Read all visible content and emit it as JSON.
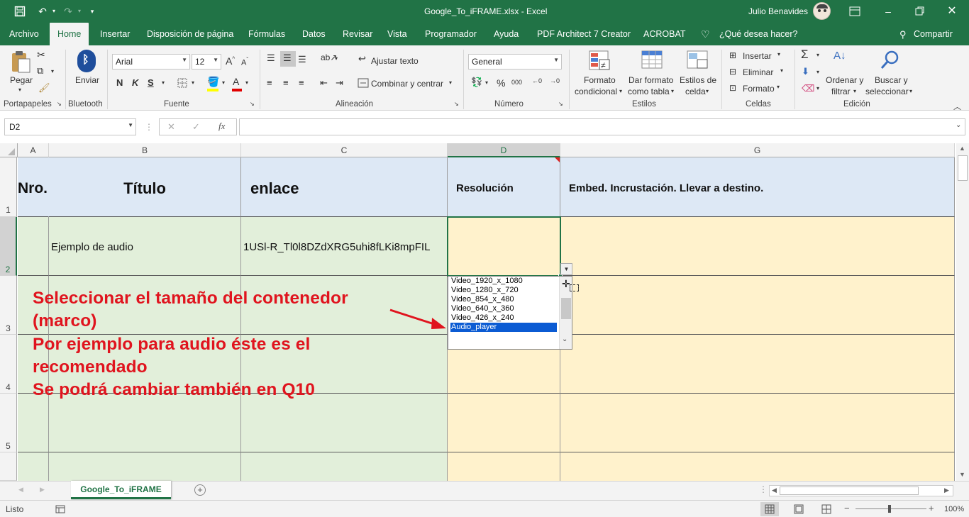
{
  "window": {
    "title": "Google_To_iFRAME.xlsx  -  Excel",
    "user": "Julio Benavides"
  },
  "tabs": [
    "Archivo",
    "Home",
    "Insertar",
    "Disposición de página",
    "Fórmulas",
    "Datos",
    "Revisar",
    "Vista",
    "Programador",
    "Ayuda",
    "PDF Architect 7 Creator",
    "ACROBAT"
  ],
  "tell_me": "¿Qué desea hacer?",
  "share": "Compartir",
  "ribbon": {
    "clipboard": {
      "paste": "Pegar",
      "label": "Portapapeles"
    },
    "bluetooth": {
      "send": "Enviar",
      "label": "Bluetooth"
    },
    "font": {
      "name": "Arial",
      "size": "12",
      "bold": "N",
      "italic": "K",
      "underline": "S",
      "label": "Fuente"
    },
    "alignment": {
      "wrap": "Ajustar texto",
      "merge": "Combinar y centrar",
      "label": "Alineación"
    },
    "number": {
      "format": "General",
      "percent": "%",
      "thousands": "000",
      "label": "Número"
    },
    "styles": {
      "conditional": [
        "Formato",
        "condicional"
      ],
      "table": [
        "Dar formato",
        "como tabla"
      ],
      "cell_styles": [
        "Estilos de",
        "celda"
      ],
      "label": "Estilos"
    },
    "cells": {
      "insert": "Insertar",
      "delete": "Eliminar",
      "format": "Formato",
      "label": "Celdas"
    },
    "editing": {
      "sort": [
        "Ordenar y",
        "filtrar"
      ],
      "find": [
        "Buscar y",
        "seleccionar"
      ],
      "label": "Edición"
    }
  },
  "formula_bar": {
    "name_box": "D2",
    "fx": "fx",
    "formula": ""
  },
  "columns": [
    "A",
    "B",
    "C",
    "D",
    "G"
  ],
  "rows": [
    "1",
    "2",
    "3",
    "4",
    "5"
  ],
  "cells": {
    "A1": "Nro.",
    "B1": "Título",
    "C1": "enlace",
    "D1": "Resolución",
    "G1": "Embed. Incrustación. Llevar a destino.",
    "B2": "Ejemplo de audio",
    "C2": "1USl-R_Tl0l8DZdXRG5uhi8fLKi8mpFIL"
  },
  "dropdown": {
    "options": [
      "Video_1920_x_1080",
      "Video_1280_x_720",
      "Video_854_x_480",
      "Video_640_x_360",
      "Video_426_x_240",
      "Audio_player"
    ],
    "selected": "Audio_player"
  },
  "annotation": {
    "lines": [
      "Seleccionar el tamaño del contenedor",
      "(marco)",
      "Por ejemplo para audio éste es el",
      "recomendado",
      "Se podrá cambiar también en Q10"
    ],
    "color": "#e0141e"
  },
  "sheet_tab": "Google_To_iFRAME",
  "status": {
    "state": "Listo",
    "zoom": "100%"
  },
  "colors": {
    "accent": "#217346",
    "header_fill": "#dde8f5",
    "row_green": "#e2efda",
    "row_yellow": "#fff2cc"
  }
}
